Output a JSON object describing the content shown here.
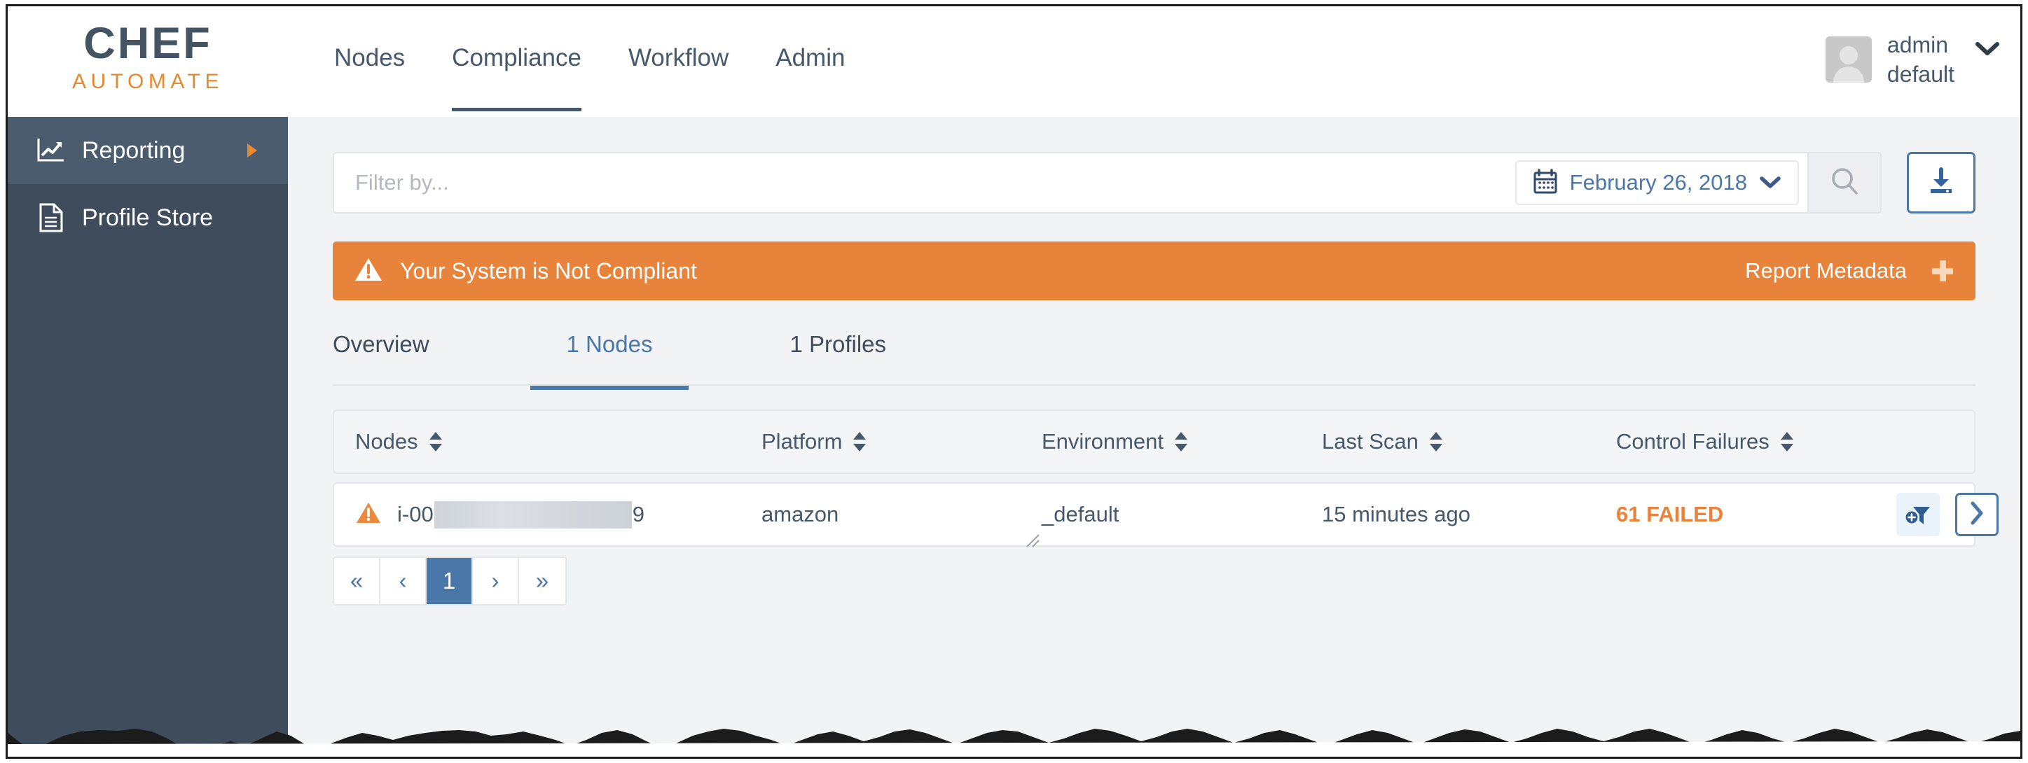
{
  "brand": {
    "name_top": "CHEF",
    "name_bottom": "AUTOMATE",
    "color_top": "#455463",
    "color_bottom": "#e8882f"
  },
  "header": {
    "nav": [
      {
        "label": "Nodes",
        "active": false
      },
      {
        "label": "Compliance",
        "active": true
      },
      {
        "label": "Workflow",
        "active": false
      },
      {
        "label": "Admin",
        "active": false
      }
    ],
    "user": {
      "name": "admin",
      "org": "default",
      "avatar_icon": "user-avatar-icon",
      "caret_icon": "chevron-down-icon"
    }
  },
  "sidebar": {
    "background": "#3e4c5c",
    "active_background": "#4b5c6e",
    "items": [
      {
        "label": "Reporting",
        "icon": "chart-line-icon",
        "active": true,
        "has_arrow": true
      },
      {
        "label": "Profile Store",
        "icon": "document-icon",
        "active": false,
        "has_arrow": false
      }
    ]
  },
  "filter_bar": {
    "placeholder": "Filter by...",
    "value": "",
    "date": "February 26, 2018",
    "date_icon": "calendar-icon",
    "date_caret_icon": "chevron-down-icon",
    "search_icon": "search-icon",
    "download_icon": "download-icon"
  },
  "banner": {
    "text": "Your System is Not Compliant",
    "action_label": "Report Metadata",
    "warning_icon": "warning-triangle-icon",
    "expand_icon": "plus-icon",
    "background": "#e8833c"
  },
  "sub_tabs": [
    {
      "label": "Overview",
      "active": false
    },
    {
      "label": "1 Nodes",
      "active": true
    },
    {
      "label": "1 Profiles",
      "active": false
    }
  ],
  "table": {
    "columns": [
      {
        "label": "Nodes",
        "sortable": true
      },
      {
        "label": "Platform",
        "sortable": true
      },
      {
        "label": "Environment",
        "sortable": true
      },
      {
        "label": "Last Scan",
        "sortable": true
      },
      {
        "label": "Control Failures",
        "sortable": true
      }
    ],
    "rows": [
      {
        "status_icon": "warning-triangle-icon",
        "node_prefix": "i-00",
        "node_redacted": true,
        "node_suffix": "9",
        "platform": "amazon",
        "environment": "_default",
        "last_scan": "15 minutes ago",
        "control_failures": "61 FAILED",
        "control_failures_color": "#e8833c",
        "add_filter_icon": "add-filter-icon",
        "detail_icon": "chevron-right-icon"
      }
    ]
  },
  "pagination": {
    "first_label": "«",
    "prev_label": "‹",
    "pages": [
      "1"
    ],
    "current_page": "1",
    "next_label": "›",
    "last_label": "»",
    "active_color": "#4a77a8"
  }
}
